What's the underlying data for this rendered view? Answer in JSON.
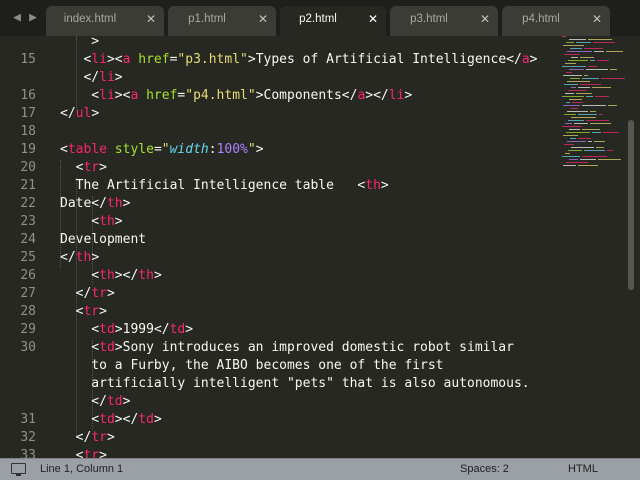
{
  "nav": {
    "prev_icon": "◀",
    "next_icon": "▶"
  },
  "tabs": [
    {
      "label": "index.html",
      "close": "✕",
      "active": false
    },
    {
      "label": "p1.html",
      "close": "✕",
      "active": false
    },
    {
      "label": "p2.html",
      "close": "✕",
      "active": true
    },
    {
      "label": "p3.html",
      "close": "✕",
      "active": false
    },
    {
      "label": "p4.html",
      "close": "✕",
      "active": false
    }
  ],
  "editor": {
    "lines": [
      {
        "num": "",
        "tokens": [
          [
            "p",
            "    >"
          ]
        ]
      },
      {
        "num": "15",
        "tokens": [
          [
            "p",
            "   <"
          ],
          [
            "t",
            "li"
          ],
          [
            "p",
            "><"
          ],
          [
            "t",
            "a"
          ],
          [
            "p",
            " "
          ],
          [
            "a",
            "href"
          ],
          [
            "p",
            "="
          ],
          [
            "s",
            "\"p3.html\""
          ],
          [
            "p",
            ">Types of Artificial Intelligence</"
          ],
          [
            "t",
            "a"
          ],
          [
            "p",
            ">"
          ]
        ]
      },
      {
        "num": "",
        "tokens": [
          [
            "p",
            "   </"
          ],
          [
            "t",
            "li"
          ],
          [
            "p",
            ">"
          ]
        ]
      },
      {
        "num": "16",
        "tokens": [
          [
            "p",
            "    <"
          ],
          [
            "t",
            "li"
          ],
          [
            "p",
            "><"
          ],
          [
            "t",
            "a"
          ],
          [
            "p",
            " "
          ],
          [
            "a",
            "href"
          ],
          [
            "p",
            "="
          ],
          [
            "s",
            "\"p4.html\""
          ],
          [
            "p",
            ">Components</"
          ],
          [
            "t",
            "a"
          ],
          [
            "p",
            "></"
          ],
          [
            "t",
            "li"
          ],
          [
            "p",
            ">"
          ]
        ]
      },
      {
        "num": "17",
        "tokens": [
          [
            "p",
            "</"
          ],
          [
            "t",
            "ul"
          ],
          [
            "p",
            ">"
          ]
        ]
      },
      {
        "num": "18",
        "tokens": []
      },
      {
        "num": "19",
        "tokens": [
          [
            "p",
            "<"
          ],
          [
            "t",
            "table"
          ],
          [
            "p",
            " "
          ],
          [
            "a",
            "style"
          ],
          [
            "p",
            "="
          ],
          [
            "s",
            "\""
          ],
          [
            "pr",
            "width"
          ],
          [
            "p",
            ":"
          ],
          [
            "n",
            "100%"
          ],
          [
            "s",
            "\""
          ],
          [
            "p",
            ">"
          ]
        ]
      },
      {
        "num": "20",
        "tokens": [
          [
            "p",
            "  <"
          ],
          [
            "t",
            "tr"
          ],
          [
            "p",
            ">"
          ]
        ]
      },
      {
        "num": "21",
        "tokens": [
          [
            "p",
            "  The Artificial Intelligence table   <"
          ],
          [
            "t",
            "th"
          ],
          [
            "p",
            ">"
          ]
        ]
      },
      {
        "num": "22",
        "tokens": [
          [
            "p",
            "Date</"
          ],
          [
            "t",
            "th"
          ],
          [
            "p",
            ">"
          ]
        ]
      },
      {
        "num": "23",
        "tokens": [
          [
            "p",
            "    <"
          ],
          [
            "t",
            "th"
          ],
          [
            "p",
            ">"
          ]
        ]
      },
      {
        "num": "24",
        "tokens": [
          [
            "p",
            "Development"
          ]
        ]
      },
      {
        "num": "25",
        "tokens": [
          [
            "p",
            "</"
          ],
          [
            "t",
            "th"
          ],
          [
            "p",
            ">"
          ]
        ]
      },
      {
        "num": "26",
        "tokens": [
          [
            "p",
            "    <"
          ],
          [
            "t",
            "th"
          ],
          [
            "p",
            "></"
          ],
          [
            "t",
            "th"
          ],
          [
            "p",
            ">"
          ]
        ]
      },
      {
        "num": "27",
        "tokens": [
          [
            "p",
            "  </"
          ],
          [
            "t",
            "tr"
          ],
          [
            "p",
            ">"
          ]
        ]
      },
      {
        "num": "28",
        "tokens": [
          [
            "p",
            "  <"
          ],
          [
            "t",
            "tr"
          ],
          [
            "p",
            ">"
          ]
        ]
      },
      {
        "num": "29",
        "tokens": [
          [
            "p",
            "    <"
          ],
          [
            "t",
            "td"
          ],
          [
            "p",
            ">1999</"
          ],
          [
            "t",
            "td"
          ],
          [
            "p",
            ">"
          ]
        ]
      },
      {
        "num": "30",
        "tokens": [
          [
            "p",
            "    <"
          ],
          [
            "t",
            "td"
          ],
          [
            "p",
            ">Sony introduces an improved domestic robot similar"
          ]
        ]
      },
      {
        "num": "",
        "tokens": [
          [
            "p",
            "    to a Furby, the AIBO becomes one of the first"
          ]
        ]
      },
      {
        "num": "",
        "tokens": [
          [
            "p",
            "    artificially intelligent \"pets\" that is also autonomous."
          ]
        ]
      },
      {
        "num": "",
        "tokens": [
          [
            "p",
            "    </"
          ],
          [
            "t",
            "td"
          ],
          [
            "p",
            ">"
          ]
        ]
      },
      {
        "num": "31",
        "tokens": [
          [
            "p",
            "    <"
          ],
          [
            "t",
            "td"
          ],
          [
            "p",
            "></"
          ],
          [
            "t",
            "td"
          ],
          [
            "p",
            ">"
          ]
        ]
      },
      {
        "num": "32",
        "tokens": [
          [
            "p",
            "  </"
          ],
          [
            "t",
            "tr"
          ],
          [
            "p",
            ">"
          ]
        ]
      },
      {
        "num": "33",
        "tokens": [
          [
            "p",
            "  <"
          ],
          [
            "t",
            "tr"
          ],
          [
            "p",
            ">"
          ]
        ]
      }
    ]
  },
  "status": {
    "position": "Line 1, Column 1",
    "spaces": "Spaces: 2",
    "syntax": "HTML"
  },
  "colors": {
    "tag": "#f92672",
    "attr": "#a6e22e",
    "string": "#e6db74",
    "number": "#ae81ff",
    "property": "#66d9ef",
    "background": "#272822"
  }
}
